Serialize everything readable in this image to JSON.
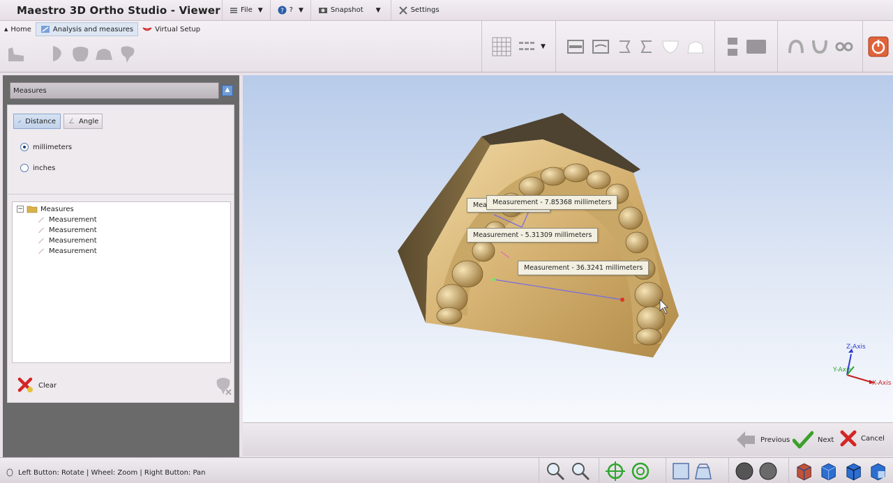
{
  "app": {
    "title": "Maestro 3D Ortho Studio - Viewer"
  },
  "menu": {
    "file": "File",
    "help": "?",
    "snapshot": "Snapshot",
    "settings": "Settings"
  },
  "tabs": [
    {
      "label": "Home"
    },
    {
      "label": "Analysis and measures"
    },
    {
      "label": "Virtual Setup"
    }
  ],
  "panel": {
    "title": "Measures",
    "modes": {
      "distance": "Distance",
      "angle": "Angle"
    },
    "units": {
      "millimeters": "millimeters",
      "inches": "inches",
      "selected": "millimeters"
    },
    "tree": {
      "root": "Measures",
      "items": [
        "Measurement",
        "Measurement",
        "Measurement",
        "Measurement"
      ]
    },
    "clear_label": "Clear"
  },
  "viewport": {
    "measurements": [
      "Measurement - 7.85368 millimeters",
      "Measurement - 5.31309 millimeters",
      "Measurement - 36.3241 millimeters"
    ],
    "hidden_tag": "Meas",
    "axes": {
      "z": "Z-Axis",
      "y": "Y-Axis",
      "x": "X-Axis"
    }
  },
  "nav": {
    "previous": "Previous",
    "next": "Next",
    "cancel": "Cancel"
  },
  "status": {
    "hint": "Left Button: Rotate | Wheel: Zoom | Right Button: Pan"
  },
  "colors": {
    "accent": "#6f9ad4",
    "model": "#d9b97a",
    "power": "#e0633a",
    "next": "#3aa02a",
    "cancel": "#d42525"
  }
}
